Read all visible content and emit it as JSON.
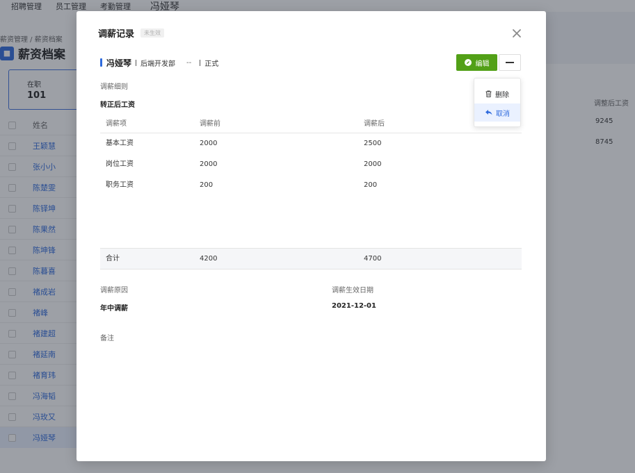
{
  "topnav": {
    "items": [
      "招聘管理",
      "员工管理",
      "考勤管理"
    ],
    "user": "冯娅琴"
  },
  "left": {
    "breadcrumb": "薪资管理 / 薪资档案",
    "page_title": "薪资档案",
    "stat": {
      "label": "在职",
      "value": "101"
    },
    "list_header": "姓名",
    "employees": [
      "王颖慧",
      "张小小",
      "陈楚雯",
      "陈铎坤",
      "陈果然",
      "陈坤锋",
      "陈暮喜",
      "褚成岩",
      "褚峰",
      "褚建超",
      "褚延南",
      "褚育玮",
      "冯海韬",
      "冯玫又",
      "冯娅琴"
    ]
  },
  "right": {
    "column_header": "调整后工资",
    "values": [
      "9245",
      "8745"
    ]
  },
  "modal": {
    "title": "调薪记录",
    "status_tag": "未生效",
    "employee": {
      "name": "冯娅琴",
      "dept": "后端开发部",
      "position": "--",
      "status": "正式"
    },
    "edit_label": "编辑",
    "menu": {
      "delete": "删除",
      "cancel": "取消"
    },
    "section_label": "调薪细则",
    "sub_title": "转正后工资",
    "table": {
      "headers": [
        "调薪项",
        "调薪前",
        "调薪后"
      ],
      "rows": [
        [
          "基本工资",
          "2000",
          "2500"
        ],
        [
          "岗位工资",
          "2000",
          "2000"
        ],
        [
          "职务工资",
          "200",
          "200"
        ]
      ],
      "total": [
        "合计",
        "4200",
        "4700"
      ]
    },
    "reason": {
      "label": "调薪原因",
      "value": "年中调薪"
    },
    "effective_date": {
      "label": "调薪生效日期",
      "value": "2021-12-01"
    },
    "remarks": {
      "label": "备注"
    }
  }
}
